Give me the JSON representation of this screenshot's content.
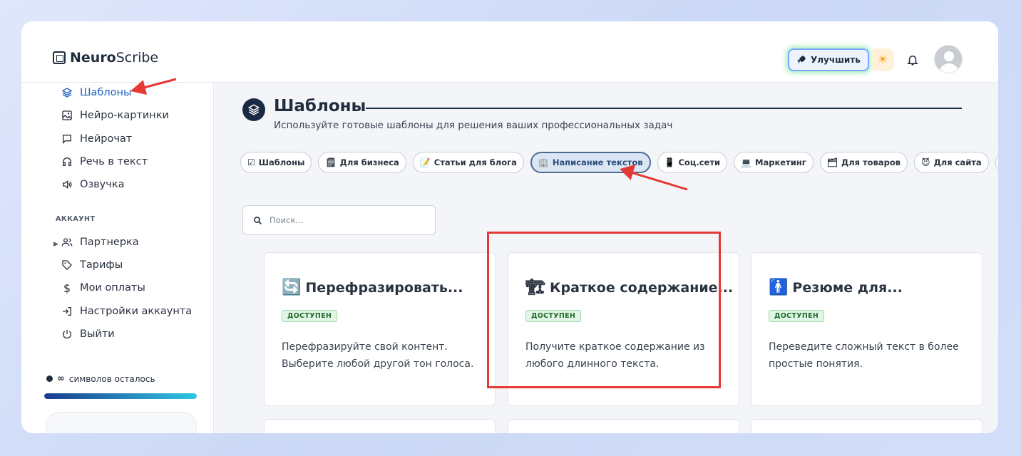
{
  "app": {
    "logo_bold": "Neuro",
    "logo_light": "Scribe",
    "upgrade_label": "Улучшить"
  },
  "sidebar": {
    "items": [
      {
        "label": "Шаблоны",
        "icon": "layers-icon",
        "active": true
      },
      {
        "label": "Нейро-картинки",
        "icon": "image-icon"
      },
      {
        "label": "Нейрочат",
        "icon": "chat-icon"
      },
      {
        "label": "Речь в текст",
        "icon": "headphones-icon"
      },
      {
        "label": "Озвучка",
        "icon": "speaker-icon"
      }
    ],
    "account_label": "АККАУНТ",
    "account_items": [
      {
        "label": "Партнерка",
        "icon": "users-icon"
      },
      {
        "label": "Тарифы",
        "icon": "tag-icon"
      },
      {
        "label": "Мои оплаты",
        "icon": "dollar-icon"
      },
      {
        "label": "Настройки аккаунта",
        "icon": "login-icon"
      },
      {
        "label": "Выйти",
        "icon": "power-icon"
      }
    ],
    "symbols_count": "∞",
    "symbols_label": "символов осталось",
    "symbols_progress": 1.0
  },
  "main": {
    "title": "Шаблоны",
    "subtitle": "Используйте готовые шаблоны для решения ваших профессиональных задач",
    "chips": [
      {
        "emoji": "☑",
        "label": "Шаблоны"
      },
      {
        "emoji": "🗒",
        "label": "Для бизнеса"
      },
      {
        "emoji": "📝",
        "label": "Статьи для блога"
      },
      {
        "emoji": "🏢",
        "label": "Написание текстов",
        "active": true
      },
      {
        "emoji": "📱",
        "label": "Соц.сети"
      },
      {
        "emoji": "💻",
        "label": "Маркетинг"
      },
      {
        "emoji": "🗂",
        "label": "Для товаров"
      },
      {
        "emoji": "😈",
        "label": "Для сайта"
      }
    ],
    "search_placeholder": "Поиск...",
    "cards": [
      {
        "emoji": "🔄",
        "title": "Перефразировать...",
        "badge": "ДОСТУПЕН",
        "desc": "Перефразируйте свой контент. Выберите любой другой тон голоса."
      },
      {
        "emoji": "🏗",
        "title": "Краткое содержание...",
        "badge": "ДОСТУПЕН",
        "desc": "Получите краткое содержание из любого длинного текста."
      },
      {
        "emoji": "🚹",
        "title": "Резюме для...",
        "badge": "ДОСТУПЕН",
        "desc": "Переведите сложный текст в более простые понятия."
      }
    ]
  },
  "annotations": {
    "arrow_color": "#e53935",
    "highlight_color": "#e53935"
  }
}
